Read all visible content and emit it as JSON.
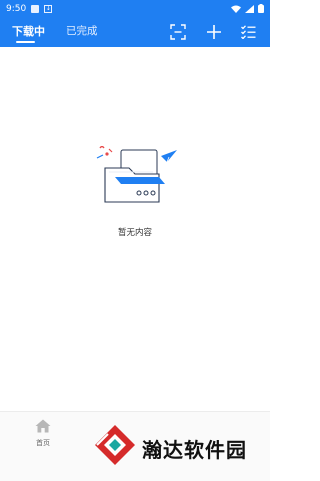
{
  "status_bar": {
    "time": "9:50",
    "icons": [
      "notification-square-icon",
      "download-notice-icon",
      "wifi-icon",
      "signal-icon",
      "battery-icon"
    ]
  },
  "app_bar": {
    "tabs": [
      {
        "label": "下载中",
        "active": true
      },
      {
        "label": "已完成",
        "active": false
      }
    ],
    "actions": [
      "scan-icon",
      "add-icon",
      "checklist-icon"
    ]
  },
  "empty_state": {
    "text": "暂无内容",
    "icon": "empty-folder-icon"
  },
  "bottom_nav": {
    "items": [
      {
        "label": "首页",
        "icon": "home-icon"
      }
    ]
  },
  "watermark": {
    "text": "瀚达软件园"
  },
  "colors": {
    "primary": "#1f7ff2",
    "background": "#ffffff",
    "text": "#333333",
    "watermark_red": "#d52b2b"
  }
}
